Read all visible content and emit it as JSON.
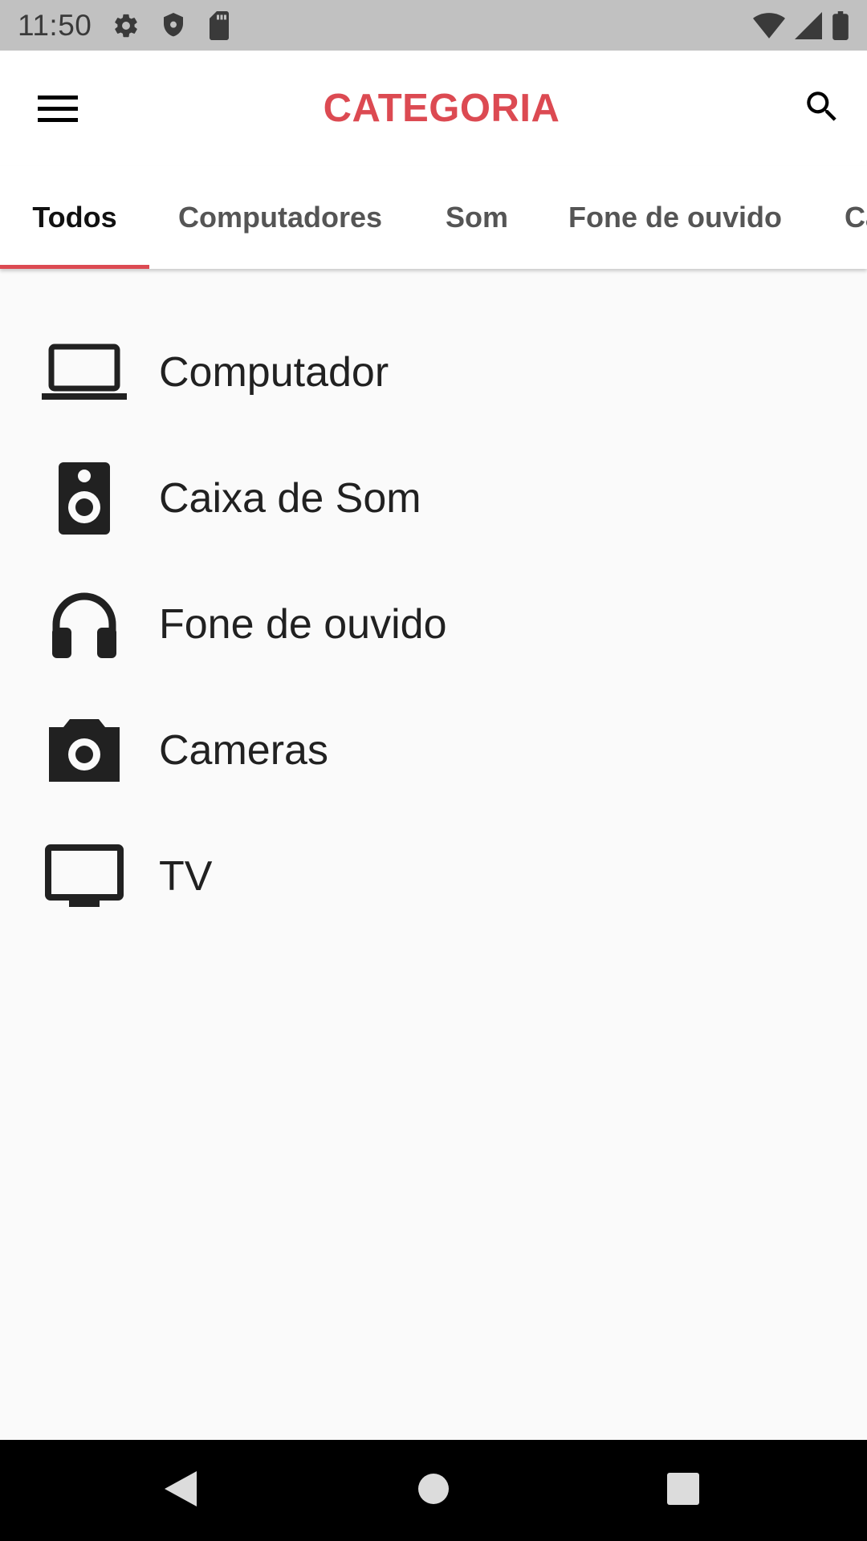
{
  "status_bar": {
    "time": "11:50",
    "left_icons": [
      "settings-icon",
      "shield-icon",
      "sd-card-icon"
    ],
    "right_icons": [
      "wifi-icon",
      "signal-icon",
      "battery-icon"
    ]
  },
  "app_bar": {
    "title": "CATEGORIA",
    "title_color": "#dc4a52",
    "menu_icon": "menu-icon",
    "search_icon": "search-icon"
  },
  "tabs": {
    "items": [
      {
        "label": "Todos",
        "active": true
      },
      {
        "label": "Computadores",
        "active": false
      },
      {
        "label": "Som",
        "active": false
      },
      {
        "label": "Fone de ouvido",
        "active": false
      },
      {
        "label": "Ca",
        "active": false
      }
    ],
    "indicator_color": "#dc4a52"
  },
  "categories": [
    {
      "label": "Computador",
      "icon": "laptop-icon"
    },
    {
      "label": "Caixa de Som",
      "icon": "speaker-icon"
    },
    {
      "label": "Fone de ouvido",
      "icon": "headphones-icon"
    },
    {
      "label": "Cameras",
      "icon": "camera-icon"
    },
    {
      "label": "TV",
      "icon": "tv-icon"
    }
  ],
  "nav_bar": {
    "buttons": [
      "back-icon",
      "home-icon",
      "recents-icon"
    ]
  }
}
